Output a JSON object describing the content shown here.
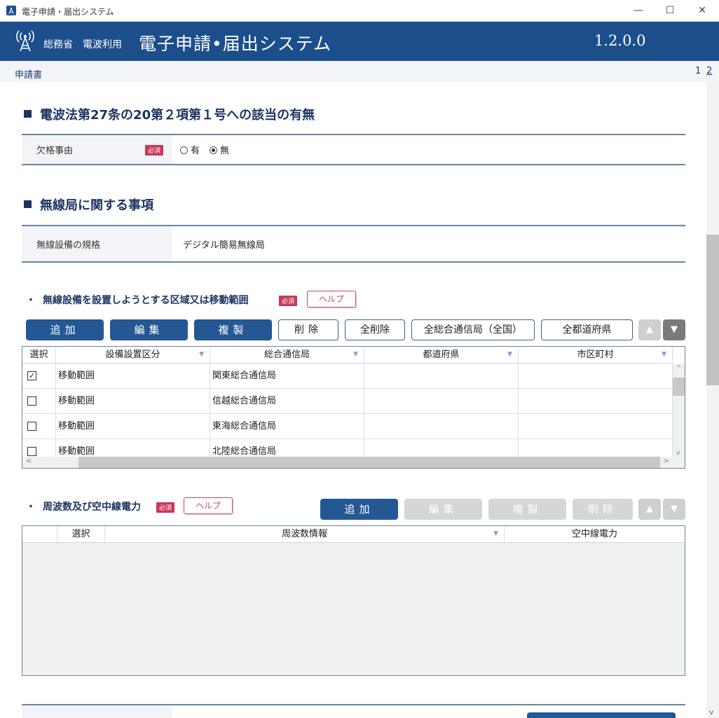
{
  "window": {
    "title": "電子申請・届出システム",
    "minimize_glyph": "—",
    "maximize_glyph": "☐",
    "close_glyph": "✕"
  },
  "header": {
    "ministry": "総務省",
    "use": "電波利用",
    "system_title": "電子申請•届出システム",
    "version": "1.2.0.0"
  },
  "subheader": {
    "document_label": "申請書",
    "pages": [
      "1",
      "2"
    ]
  },
  "section1": {
    "title": "電波法第27条の20第２項第１号への該当の有無",
    "field_label": "欠格事由",
    "required_badge": "必須",
    "options": [
      {
        "label": "有",
        "selected": false
      },
      {
        "label": "無",
        "selected": true
      }
    ]
  },
  "section2": {
    "title": "無線局に関する事項",
    "field_label": "無線設備の規格",
    "field_value": "デジタル簡易無線局"
  },
  "area": {
    "title": "無線設備を設置しようとする区域又は移動範囲",
    "required_badge": "必須",
    "help_label": "ヘルプ",
    "buttons": {
      "add": "追加",
      "edit": "編集",
      "copy": "複製",
      "delete": "削除",
      "delete_all": "全削除",
      "all_bureaus": "全総合通信局（全国）",
      "all_prefectures": "全都道府県",
      "up": "▲",
      "down": "▼"
    },
    "columns": [
      "選択",
      "設備設置区分",
      "総合通信局",
      "都道府県",
      "市区町村"
    ],
    "rows": [
      {
        "checked": true,
        "category": "移動範囲",
        "bureau": "関東総合通信局",
        "prefecture": "",
        "city": ""
      },
      {
        "checked": false,
        "category": "移動範囲",
        "bureau": "信越総合通信局",
        "prefecture": "",
        "city": ""
      },
      {
        "checked": false,
        "category": "移動範囲",
        "bureau": "東海総合通信局",
        "prefecture": "",
        "city": ""
      },
      {
        "checked": false,
        "category": "移動範囲",
        "bureau": "北陸総合通信局",
        "prefecture": "",
        "city": ""
      }
    ],
    "check_glyph": "✓"
  },
  "frequency": {
    "title": "周波数及び空中線電力",
    "required_badge": "必須",
    "help_label": "ヘルプ",
    "buttons": {
      "add": "追加",
      "edit": "編集",
      "copy": "複製",
      "delete": "削除",
      "up": "▲",
      "down": "▼"
    },
    "columns": [
      "",
      "選択",
      "周波数情報",
      "空中線電力"
    ]
  },
  "glyphs": {
    "sort": "▼",
    "dot": "・",
    "scroll_up": "^",
    "scroll_down": "v",
    "scroll_left": "<",
    "scroll_right": ">"
  }
}
